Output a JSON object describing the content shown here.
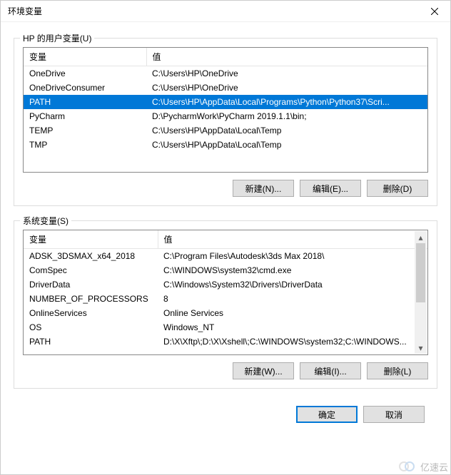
{
  "title": "环境变量",
  "user_section": {
    "label": "HP 的用户变量(U)",
    "headers": {
      "var": "变量",
      "val": "值"
    },
    "rows": [
      {
        "var": "OneDrive",
        "val": "C:\\Users\\HP\\OneDrive",
        "selected": false
      },
      {
        "var": "OneDriveConsumer",
        "val": "C:\\Users\\HP\\OneDrive",
        "selected": false
      },
      {
        "var": "PATH",
        "val": "C:\\Users\\HP\\AppData\\Local\\Programs\\Python\\Python37\\Scri...",
        "selected": true
      },
      {
        "var": "PyCharm",
        "val": "D:\\PycharmWork\\PyCharm 2019.1.1\\bin;",
        "selected": false
      },
      {
        "var": "TEMP",
        "val": "C:\\Users\\HP\\AppData\\Local\\Temp",
        "selected": false
      },
      {
        "var": "TMP",
        "val": "C:\\Users\\HP\\AppData\\Local\\Temp",
        "selected": false
      }
    ],
    "buttons": {
      "new": "新建(N)...",
      "edit": "编辑(E)...",
      "delete": "删除(D)"
    }
  },
  "system_section": {
    "label": "系统变量(S)",
    "headers": {
      "var": "变量",
      "val": "值"
    },
    "rows": [
      {
        "var": "ADSK_3DSMAX_x64_2018",
        "val": "C:\\Program Files\\Autodesk\\3ds Max 2018\\"
      },
      {
        "var": "ComSpec",
        "val": "C:\\WINDOWS\\system32\\cmd.exe"
      },
      {
        "var": "DriverData",
        "val": "C:\\Windows\\System32\\Drivers\\DriverData"
      },
      {
        "var": "NUMBER_OF_PROCESSORS",
        "val": "8"
      },
      {
        "var": "OnlineServices",
        "val": "Online Services"
      },
      {
        "var": "OS",
        "val": "Windows_NT"
      },
      {
        "var": "PATH",
        "val": "D:\\X\\Xftp\\;D:\\X\\Xshell\\;C:\\WINDOWS\\system32;C:\\WINDOWS..."
      }
    ],
    "buttons": {
      "new": "新建(W)...",
      "edit": "编辑(I)...",
      "delete": "删除(L)"
    }
  },
  "dialog_buttons": {
    "ok": "确定",
    "cancel": "取消"
  },
  "watermark": "亿速云"
}
